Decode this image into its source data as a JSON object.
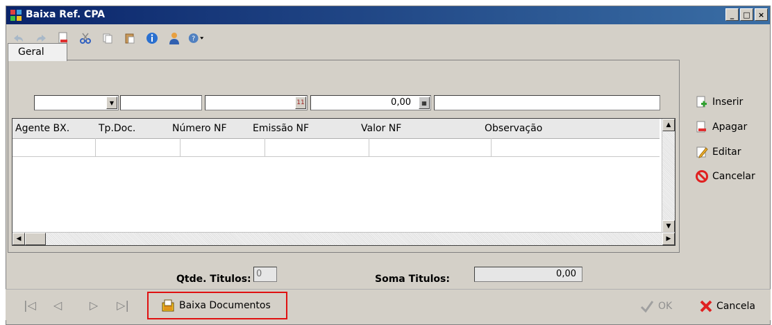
{
  "window": {
    "title": "Baixa Ref. CPA",
    "min_label": "_",
    "max_label": "□",
    "close_label": "×"
  },
  "tabs": [
    {
      "label": "Geral"
    }
  ],
  "filters": {
    "value_field": "0,00"
  },
  "grid": {
    "columns": [
      "Agente BX.",
      "Tp.Doc.",
      "Número NF",
      "Emissão NF",
      "Valor NF",
      "Observação"
    ]
  },
  "side_actions": {
    "inserir": "Inserir",
    "apagar": "Apagar",
    "editar": "Editar",
    "cancelar": "Cancelar"
  },
  "summary": {
    "qtde_label": "Qtde. Titulos:",
    "qtde_value": "0",
    "soma_label": "Soma Titulos:",
    "soma_value": "0,00"
  },
  "bottom": {
    "baixa_label": "Baixa Documentos",
    "ok_label": "OK",
    "cancela_label": "Cancela"
  },
  "colors": {
    "highlight": "#e01010",
    "title_bar": "#0a246a"
  }
}
